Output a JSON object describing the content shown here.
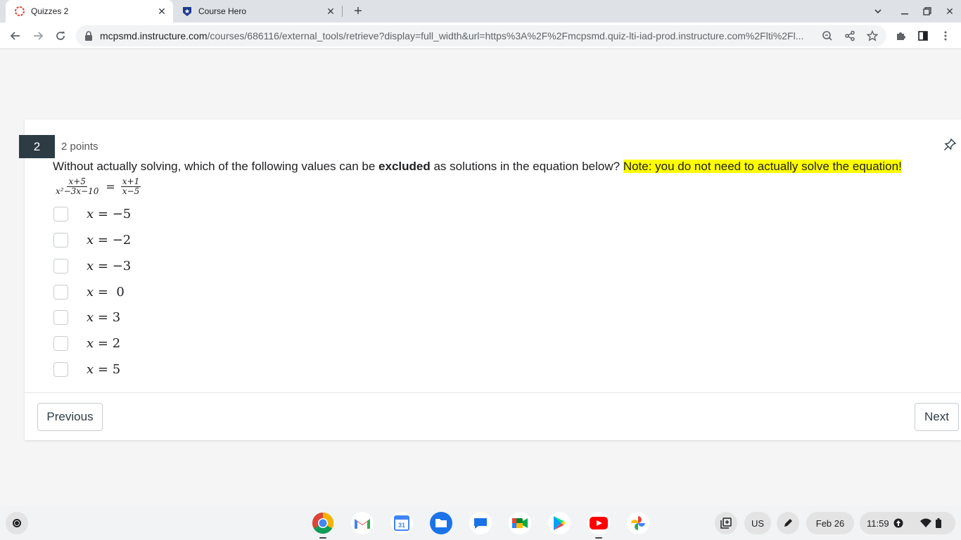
{
  "browser": {
    "tabs": [
      {
        "title": "Quizzes 2",
        "active": true
      },
      {
        "title": "Course Hero",
        "active": false
      }
    ],
    "url_host": "mcpsmd.instructure.com",
    "url_path": "/courses/686116/external_tools/retrieve?display=full_width&url=https%3A%2F%2Fmcpsmd.quiz-lti-iad-prod.instructure.com%2Flti%2Fl..."
  },
  "question": {
    "number": "2",
    "points": "2 points",
    "text_before": "Without actually solving, which of the following values can be ",
    "text_bold": "excluded",
    "text_after": " as solutions in the equation below? ",
    "note": "Note: you do not need to actually solve the equation!",
    "equation": {
      "left_num": "x+5",
      "left_den": "x²−3x−10",
      "right_num": "x+1",
      "right_den": "x−5"
    },
    "options": [
      {
        "var": "x",
        "value": "−5"
      },
      {
        "var": "x",
        "value": "−2"
      },
      {
        "var": "x",
        "value": "−3"
      },
      {
        "var": "x",
        "value": "0"
      },
      {
        "var": "x",
        "value": "3"
      },
      {
        "var": "x",
        "value": "2"
      },
      {
        "var": "x",
        "value": "5"
      }
    ]
  },
  "nav": {
    "previous": "Previous",
    "next": "Next"
  },
  "shelf": {
    "ime": "US",
    "date": "Feb 26",
    "time": "11:59"
  },
  "colors": {
    "question_badge": "#2d3b45",
    "highlight": "#ffff00"
  }
}
